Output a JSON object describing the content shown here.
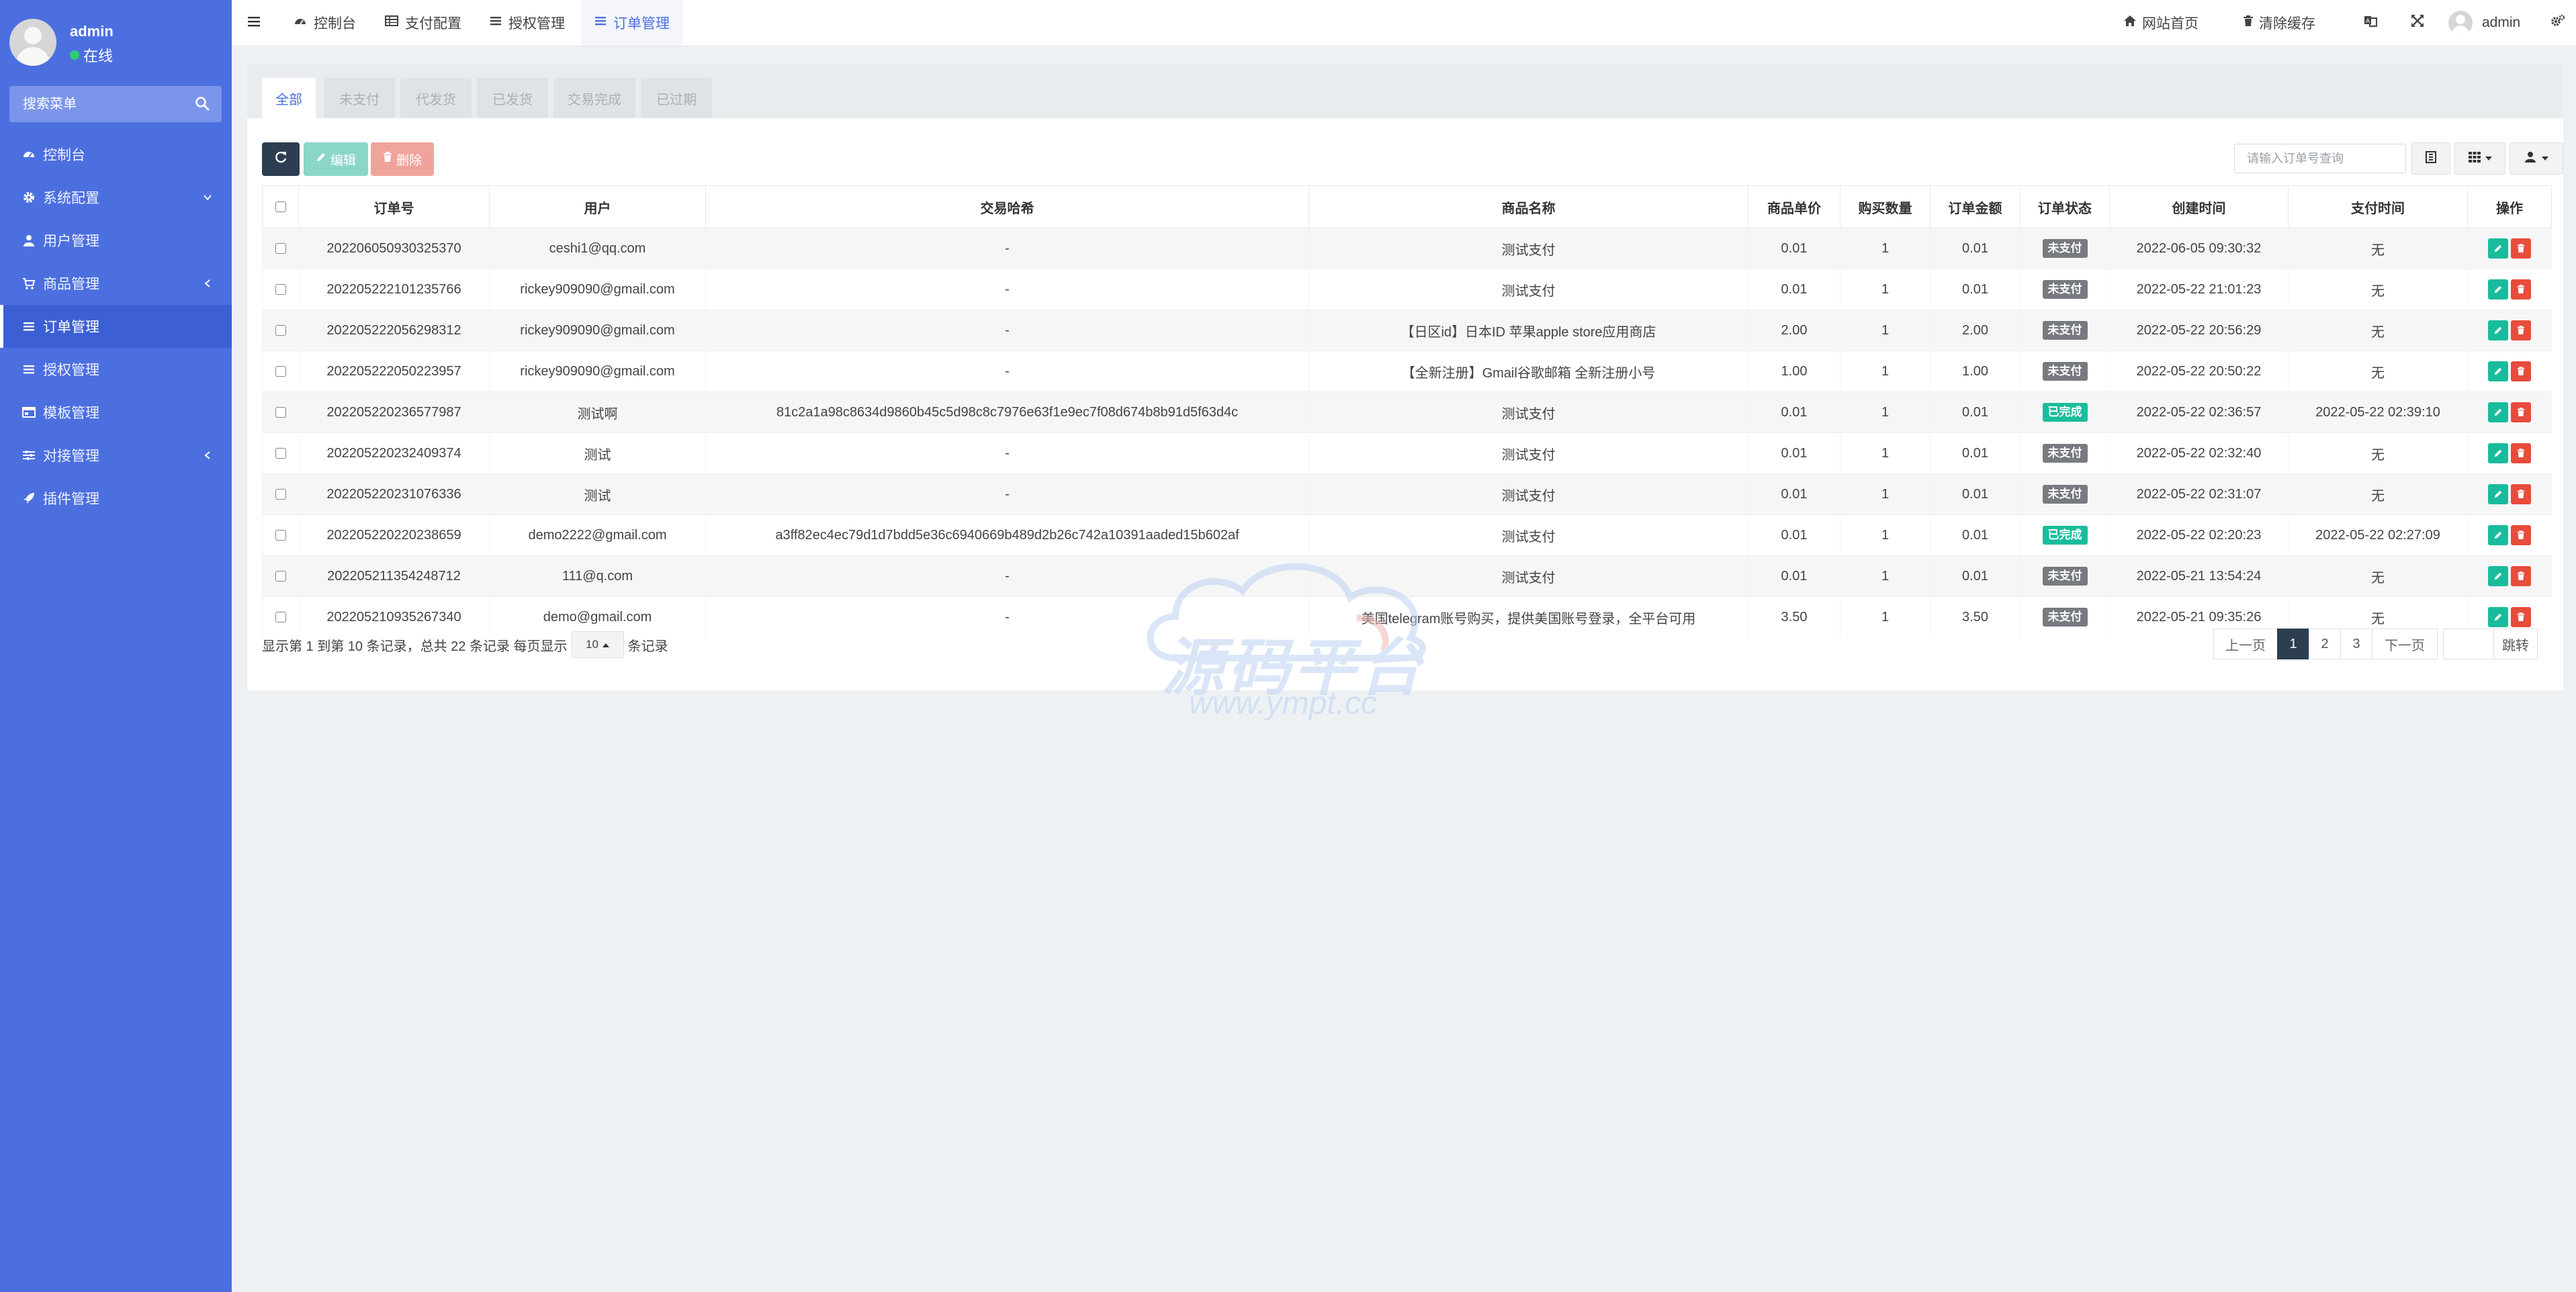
{
  "sidebar": {
    "user_name": "admin",
    "user_status": "在线",
    "search_placeholder": "搜索菜单",
    "items": [
      {
        "label": "控制台",
        "icon": "dashboard-icon"
      },
      {
        "label": "系统配置",
        "icon": "gear-icon"
      },
      {
        "label": "用户管理",
        "icon": "user-icon"
      },
      {
        "label": "商品管理",
        "icon": "cart-icon"
      },
      {
        "label": "订单管理",
        "icon": "list-icon"
      },
      {
        "label": "授权管理",
        "icon": "list-icon"
      },
      {
        "label": "模板管理",
        "icon": "template-icon"
      },
      {
        "label": "对接管理",
        "icon": "sliders-icon"
      },
      {
        "label": "插件管理",
        "icon": "rocket-icon"
      }
    ]
  },
  "topbar": {
    "tabs": [
      {
        "label": "控制台"
      },
      {
        "label": "支付配置"
      },
      {
        "label": "授权管理"
      },
      {
        "label": "订单管理"
      }
    ],
    "site_home": "网站首页",
    "clear_cache": "清除缓存",
    "user": "admin"
  },
  "filters": {
    "tabs": [
      "全部",
      "未支付",
      "代发货",
      "已发货",
      "交易完成",
      "已过期"
    ]
  },
  "toolbar": {
    "edit_label": "编辑",
    "delete_label": "删除",
    "search_placeholder": "请输入订单号查询"
  },
  "table": {
    "headers": [
      "订单号",
      "用户",
      "交易哈希",
      "商品名称",
      "商品单价",
      "购买数量",
      "订单金额",
      "订单状态",
      "创建时间",
      "支付时间",
      "操作"
    ],
    "rows": [
      {
        "order_no": "202206050930325370",
        "user": "ceshi1@qq.com",
        "hash": "-",
        "product": "测试支付",
        "price": "0.01",
        "qty": "1",
        "amount": "0.01",
        "status": "未支付",
        "status_type": "unpaid",
        "created": "2022-06-05 09:30:32",
        "paid": "无"
      },
      {
        "order_no": "202205222101235766",
        "user": "rickey909090@gmail.com",
        "hash": "-",
        "product": "测试支付",
        "price": "0.01",
        "qty": "1",
        "amount": "0.01",
        "status": "未支付",
        "status_type": "unpaid",
        "created": "2022-05-22 21:01:23",
        "paid": "无"
      },
      {
        "order_no": "202205222056298312",
        "user": "rickey909090@gmail.com",
        "hash": "-",
        "product": "【日区id】日本ID 苹果apple store应用商店",
        "price": "2.00",
        "qty": "1",
        "amount": "2.00",
        "status": "未支付",
        "status_type": "unpaid",
        "created": "2022-05-22 20:56:29",
        "paid": "无"
      },
      {
        "order_no": "202205222050223957",
        "user": "rickey909090@gmail.com",
        "hash": "-",
        "product": "【全新注册】Gmail谷歌邮箱 全新注册小号",
        "price": "1.00",
        "qty": "1",
        "amount": "1.00",
        "status": "未支付",
        "status_type": "unpaid",
        "created": "2022-05-22 20:50:22",
        "paid": "无"
      },
      {
        "order_no": "202205220236577987",
        "user": "测试啊",
        "hash": "81c2a1a98c8634d9860b45c5d98c8c7976e63f1e9ec7f08d674b8b91d5f63d4c",
        "product": "测试支付",
        "price": "0.01",
        "qty": "1",
        "amount": "0.01",
        "status": "已完成",
        "status_type": "done",
        "created": "2022-05-22 02:36:57",
        "paid": "2022-05-22 02:39:10"
      },
      {
        "order_no": "202205220232409374",
        "user": "测试",
        "hash": "-",
        "product": "测试支付",
        "price": "0.01",
        "qty": "1",
        "amount": "0.01",
        "status": "未支付",
        "status_type": "unpaid",
        "created": "2022-05-22 02:32:40",
        "paid": "无"
      },
      {
        "order_no": "202205220231076336",
        "user": "测试",
        "hash": "-",
        "product": "测试支付",
        "price": "0.01",
        "qty": "1",
        "amount": "0.01",
        "status": "未支付",
        "status_type": "unpaid",
        "created": "2022-05-22 02:31:07",
        "paid": "无"
      },
      {
        "order_no": "202205220220238659",
        "user": "demo2222@gmail.com",
        "hash": "a3ff82ec4ec79d1d7bdd5e36c6940669b489d2b26c742a10391aaded15b602af",
        "product": "测试支付",
        "price": "0.01",
        "qty": "1",
        "amount": "0.01",
        "status": "已完成",
        "status_type": "done",
        "created": "2022-05-22 02:20:23",
        "paid": "2022-05-22 02:27:09"
      },
      {
        "order_no": "202205211354248712",
        "user": "111@q.com",
        "hash": "-",
        "product": "测试支付",
        "price": "0.01",
        "qty": "1",
        "amount": "0.01",
        "status": "未支付",
        "status_type": "unpaid",
        "created": "2022-05-21 13:54:24",
        "paid": "无"
      },
      {
        "order_no": "202205210935267340",
        "user": "demo@gmail.com",
        "hash": "-",
        "product": "美国telegram账号购买，提供美国账号登录，全平台可用",
        "price": "3.50",
        "qty": "1",
        "amount": "3.50",
        "status": "未支付",
        "status_type": "unpaid",
        "created": "2022-05-21 09:35:26",
        "paid": "无"
      }
    ]
  },
  "pagination": {
    "info_prefix": "显示第 1 到第 10 条记录，总共 22 条记录 每页显示",
    "page_size": "10",
    "info_suffix": "条记录",
    "prev": "上一页",
    "pages": [
      "1",
      "2",
      "3"
    ],
    "next": "下一页",
    "jump": "跳转"
  },
  "watermark": {
    "text": "源码平台",
    "url": "www.ympt.cc"
  },
  "colors": {
    "sidebar": "#4c6fe0",
    "accent": "#4c6fe0",
    "success": "#18bc9c",
    "danger": "#e74c3c",
    "unpaid_badge": "#777b80",
    "dark_button": "#2c3e50"
  }
}
